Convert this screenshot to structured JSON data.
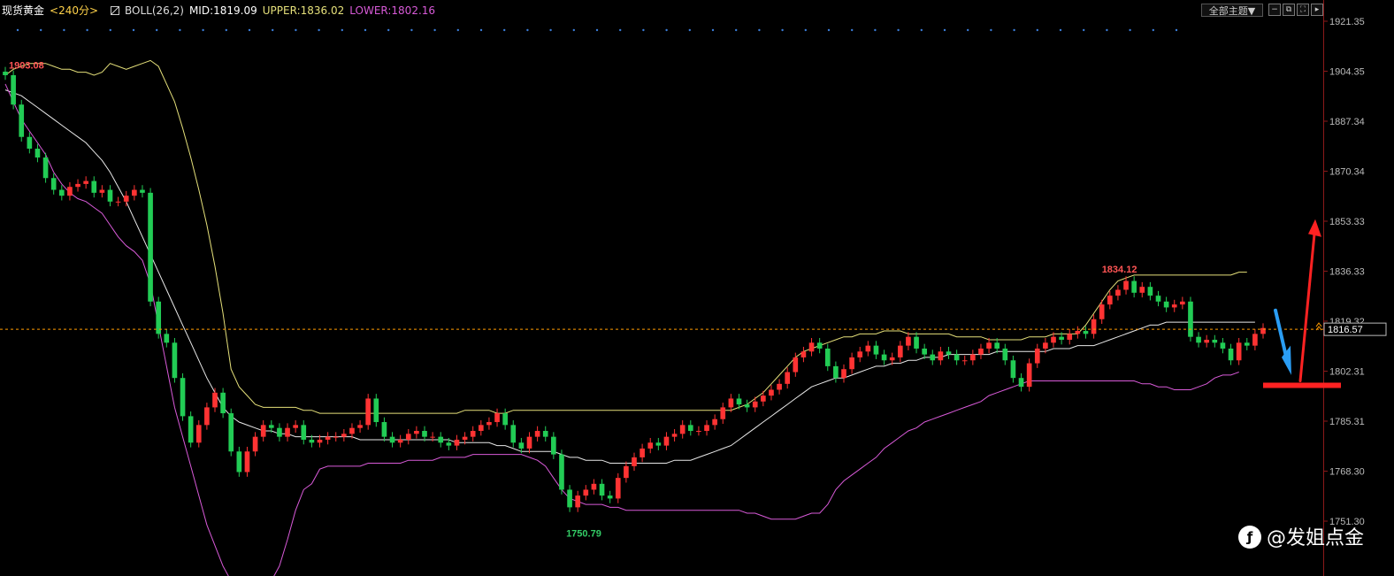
{
  "header": {
    "symbol": "现货黄金",
    "period": "<240分>",
    "indicator": "BOLL(26,2)",
    "mid": "MID:1819.09",
    "upper": "UPPER:1836.02",
    "lower": "LOWER:1802.16",
    "theme_select": "全部主题▼"
  },
  "toolbar_icons": [
    "minus-icon",
    "window-restore-icon",
    "fullscreen-icon",
    "next-icon"
  ],
  "axis": {
    "ticks": [
      1921.35,
      1904.35,
      1887.34,
      1870.34,
      1853.33,
      1836.33,
      1819.32,
      1802.31,
      1785.31,
      1768.3,
      1751.3
    ],
    "tick_labels": [
      "1921.35",
      "1904.35",
      "1887.34",
      "1870.34",
      "1853.33",
      "1836.33",
      "1819.32",
      "1802.31",
      "1785.31",
      "1768.30",
      "1751.30"
    ],
    "current_price": 1816.57,
    "current_label": "1816.57"
  },
  "annotations": {
    "high_start": {
      "label": "1903.08",
      "value": 1903.08,
      "candle": 0
    },
    "low": {
      "label": "1750.79",
      "value": 1750.79,
      "candle": 70
    },
    "high_end": {
      "label": "1834.12",
      "value": 1834.12,
      "candle": 136
    }
  },
  "watermark": "@发姐点金",
  "colors": {
    "background": "#000000",
    "up": "#ff3333",
    "down": "#22cc55",
    "mid": "#e8e8e8",
    "upper": "#e5e07a",
    "lower": "#d85ad8",
    "current_line": "#ff9900",
    "arrow_blue": "#2a9df4",
    "arrow_red": "#ff2222"
  },
  "chart_data": {
    "type": "candlestick",
    "ylim": [
      1751.3,
      1921.35
    ],
    "closes": [
      1903,
      1893,
      1882,
      1878,
      1875,
      1868,
      1864,
      1862,
      1865,
      1866,
      1867,
      1863,
      1864,
      1860,
      1860,
      1862,
      1864,
      1863,
      1826,
      1815,
      1812,
      1800,
      1787,
      1778,
      1784,
      1790,
      1795,
      1788,
      1775,
      1768,
      1775,
      1780,
      1784,
      1783,
      1780,
      1783,
      1784,
      1779,
      1778,
      1779,
      1780,
      1780,
      1781,
      1783,
      1784,
      1793,
      1785,
      1780,
      1778,
      1779,
      1781,
      1782,
      1780,
      1780,
      1778,
      1777,
      1779,
      1780,
      1782,
      1784,
      1785,
      1788,
      1784,
      1778,
      1776,
      1780,
      1782,
      1780,
      1774,
      1762,
      1756,
      1760,
      1762,
      1764,
      1760,
      1759,
      1766,
      1770,
      1773,
      1776,
      1778,
      1777,
      1780,
      1781,
      1784,
      1782,
      1782,
      1784,
      1786,
      1790,
      1793,
      1791,
      1790,
      1792,
      1794,
      1796,
      1798,
      1802,
      1807,
      1809,
      1812,
      1810,
      1804,
      1800,
      1803,
      1807,
      1809,
      1811,
      1808,
      1806,
      1807,
      1811,
      1814,
      1810,
      1808,
      1806,
      1809,
      1808,
      1806,
      1806,
      1808,
      1810,
      1812,
      1810,
      1806,
      1800,
      1797,
      1805,
      1810,
      1812,
      1814,
      1813,
      1815,
      1816,
      1815,
      1820,
      1825,
      1828,
      1830,
      1833,
      1829,
      1831,
      1828,
      1826,
      1824,
      1825,
      1826,
      1814,
      1812,
      1813,
      1812,
      1810,
      1806,
      1812,
      1811,
      1815,
      1817
    ],
    "series": [
      {
        "name": "MID",
        "values": [
          1898,
          1897,
          1896,
          1894,
          1892,
          1890,
          1888,
          1886,
          1884,
          1882,
          1880,
          1877,
          1874,
          1870,
          1865,
          1860,
          1854,
          1848,
          1842,
          1836,
          1830,
          1824,
          1818,
          1812,
          1806,
          1800,
          1795,
          1790,
          1787,
          1785,
          1784,
          1783,
          1782,
          1782,
          1781,
          1781,
          1780,
          1780,
          1780,
          1780,
          1780,
          1780,
          1780,
          1780,
          1779,
          1779,
          1779,
          1779,
          1779,
          1779,
          1779,
          1779,
          1779,
          1779,
          1779,
          1779,
          1778,
          1778,
          1778,
          1778,
          1778,
          1777,
          1777,
          1776,
          1775,
          1775,
          1775,
          1775,
          1775,
          1774,
          1773,
          1773,
          1772,
          1772,
          1772,
          1771,
          1771,
          1771,
          1771,
          1771,
          1771,
          1771,
          1771,
          1772,
          1772,
          1772,
          1773,
          1774,
          1775,
          1776,
          1777,
          1779,
          1781,
          1783,
          1785,
          1787,
          1789,
          1791,
          1793,
          1795,
          1797,
          1798,
          1799,
          1800,
          1800,
          1801,
          1802,
          1803,
          1804,
          1804,
          1805,
          1805,
          1806,
          1806,
          1807,
          1807,
          1807,
          1808,
          1808,
          1808,
          1808,
          1808,
          1808,
          1809,
          1809,
          1809,
          1809,
          1809,
          1809,
          1809,
          1810,
          1810,
          1810,
          1811,
          1811,
          1811,
          1812,
          1813,
          1814,
          1815,
          1816,
          1817,
          1818,
          1818,
          1819,
          1819,
          1819,
          1819,
          1819,
          1819,
          1819,
          1819,
          1819,
          1819,
          1819,
          1819
        ]
      },
      {
        "name": "UPPER",
        "values": [
          1903,
          1905,
          1906,
          1907,
          1907,
          1907,
          1906,
          1905,
          1905,
          1904,
          1904,
          1903,
          1904,
          1907,
          1906,
          1905,
          1906,
          1907,
          1908,
          1906,
          1900,
          1894,
          1885,
          1875,
          1864,
          1852,
          1838,
          1822,
          1803,
          1797,
          1794,
          1791,
          1790,
          1790,
          1790,
          1790,
          1790,
          1789,
          1789,
          1788,
          1788,
          1788,
          1788,
          1788,
          1788,
          1788,
          1788,
          1788,
          1788,
          1788,
          1788,
          1788,
          1788,
          1788,
          1788,
          1788,
          1788,
          1789,
          1789,
          1789,
          1789,
          1788,
          1788,
          1789,
          1789,
          1789,
          1789,
          1789,
          1789,
          1789,
          1789,
          1789,
          1789,
          1789,
          1789,
          1789,
          1789,
          1789,
          1789,
          1789,
          1789,
          1789,
          1789,
          1789,
          1789,
          1789,
          1789,
          1789,
          1789,
          1789,
          1789,
          1790,
          1791,
          1793,
          1795,
          1798,
          1801,
          1804,
          1807,
          1809,
          1810,
          1811,
          1812,
          1813,
          1814,
          1814,
          1815,
          1815,
          1815,
          1816,
          1816,
          1816,
          1815,
          1815,
          1815,
          1815,
          1815,
          1815,
          1814,
          1814,
          1814,
          1814,
          1813,
          1813,
          1813,
          1813,
          1813,
          1814,
          1814,
          1814,
          1815,
          1815,
          1815,
          1815,
          1818,
          1822,
          1826,
          1830,
          1833,
          1834,
          1835,
          1835,
          1835,
          1835,
          1835,
          1835,
          1835,
          1835,
          1835,
          1835,
          1835,
          1835,
          1835,
          1836,
          1836
        ]
      },
      {
        "name": "LOWER",
        "values": [
          1900,
          1894,
          1888,
          1884,
          1880,
          1876,
          1870,
          1866,
          1863,
          1861,
          1860,
          1858,
          1856,
          1852,
          1848,
          1845,
          1843,
          1840,
          1832,
          1818,
          1804,
          1790,
          1780,
          1770,
          1760,
          1750,
          1743,
          1736,
          1731,
          1729,
          1728,
          1728,
          1729,
          1731,
          1736,
          1745,
          1755,
          1762,
          1764,
          1769,
          1770,
          1770,
          1770,
          1770,
          1770,
          1771,
          1771,
          1771,
          1771,
          1771,
          1772,
          1772,
          1772,
          1772,
          1773,
          1773,
          1773,
          1773,
          1774,
          1774,
          1774,
          1774,
          1774,
          1774,
          1774,
          1773,
          1772,
          1770,
          1766,
          1762,
          1759,
          1758,
          1757,
          1757,
          1757,
          1756,
          1756,
          1755,
          1755,
          1755,
          1755,
          1755,
          1755,
          1755,
          1755,
          1755,
          1755,
          1755,
          1755,
          1755,
          1755,
          1755,
          1754,
          1754,
          1753,
          1752,
          1752,
          1752,
          1752,
          1753,
          1754,
          1754,
          1757,
          1762,
          1765,
          1767,
          1769,
          1771,
          1773,
          1776,
          1778,
          1780,
          1782,
          1783,
          1785,
          1786,
          1787,
          1788,
          1789,
          1790,
          1791,
          1792,
          1794,
          1795,
          1796,
          1797,
          1798,
          1799,
          1799,
          1799,
          1799,
          1799,
          1799,
          1799,
          1799,
          1799,
          1799,
          1799,
          1799,
          1799,
          1799,
          1798,
          1798,
          1797,
          1797,
          1796,
          1796,
          1796,
          1797,
          1798,
          1800,
          1801,
          1801,
          1802
        ]
      }
    ]
  }
}
